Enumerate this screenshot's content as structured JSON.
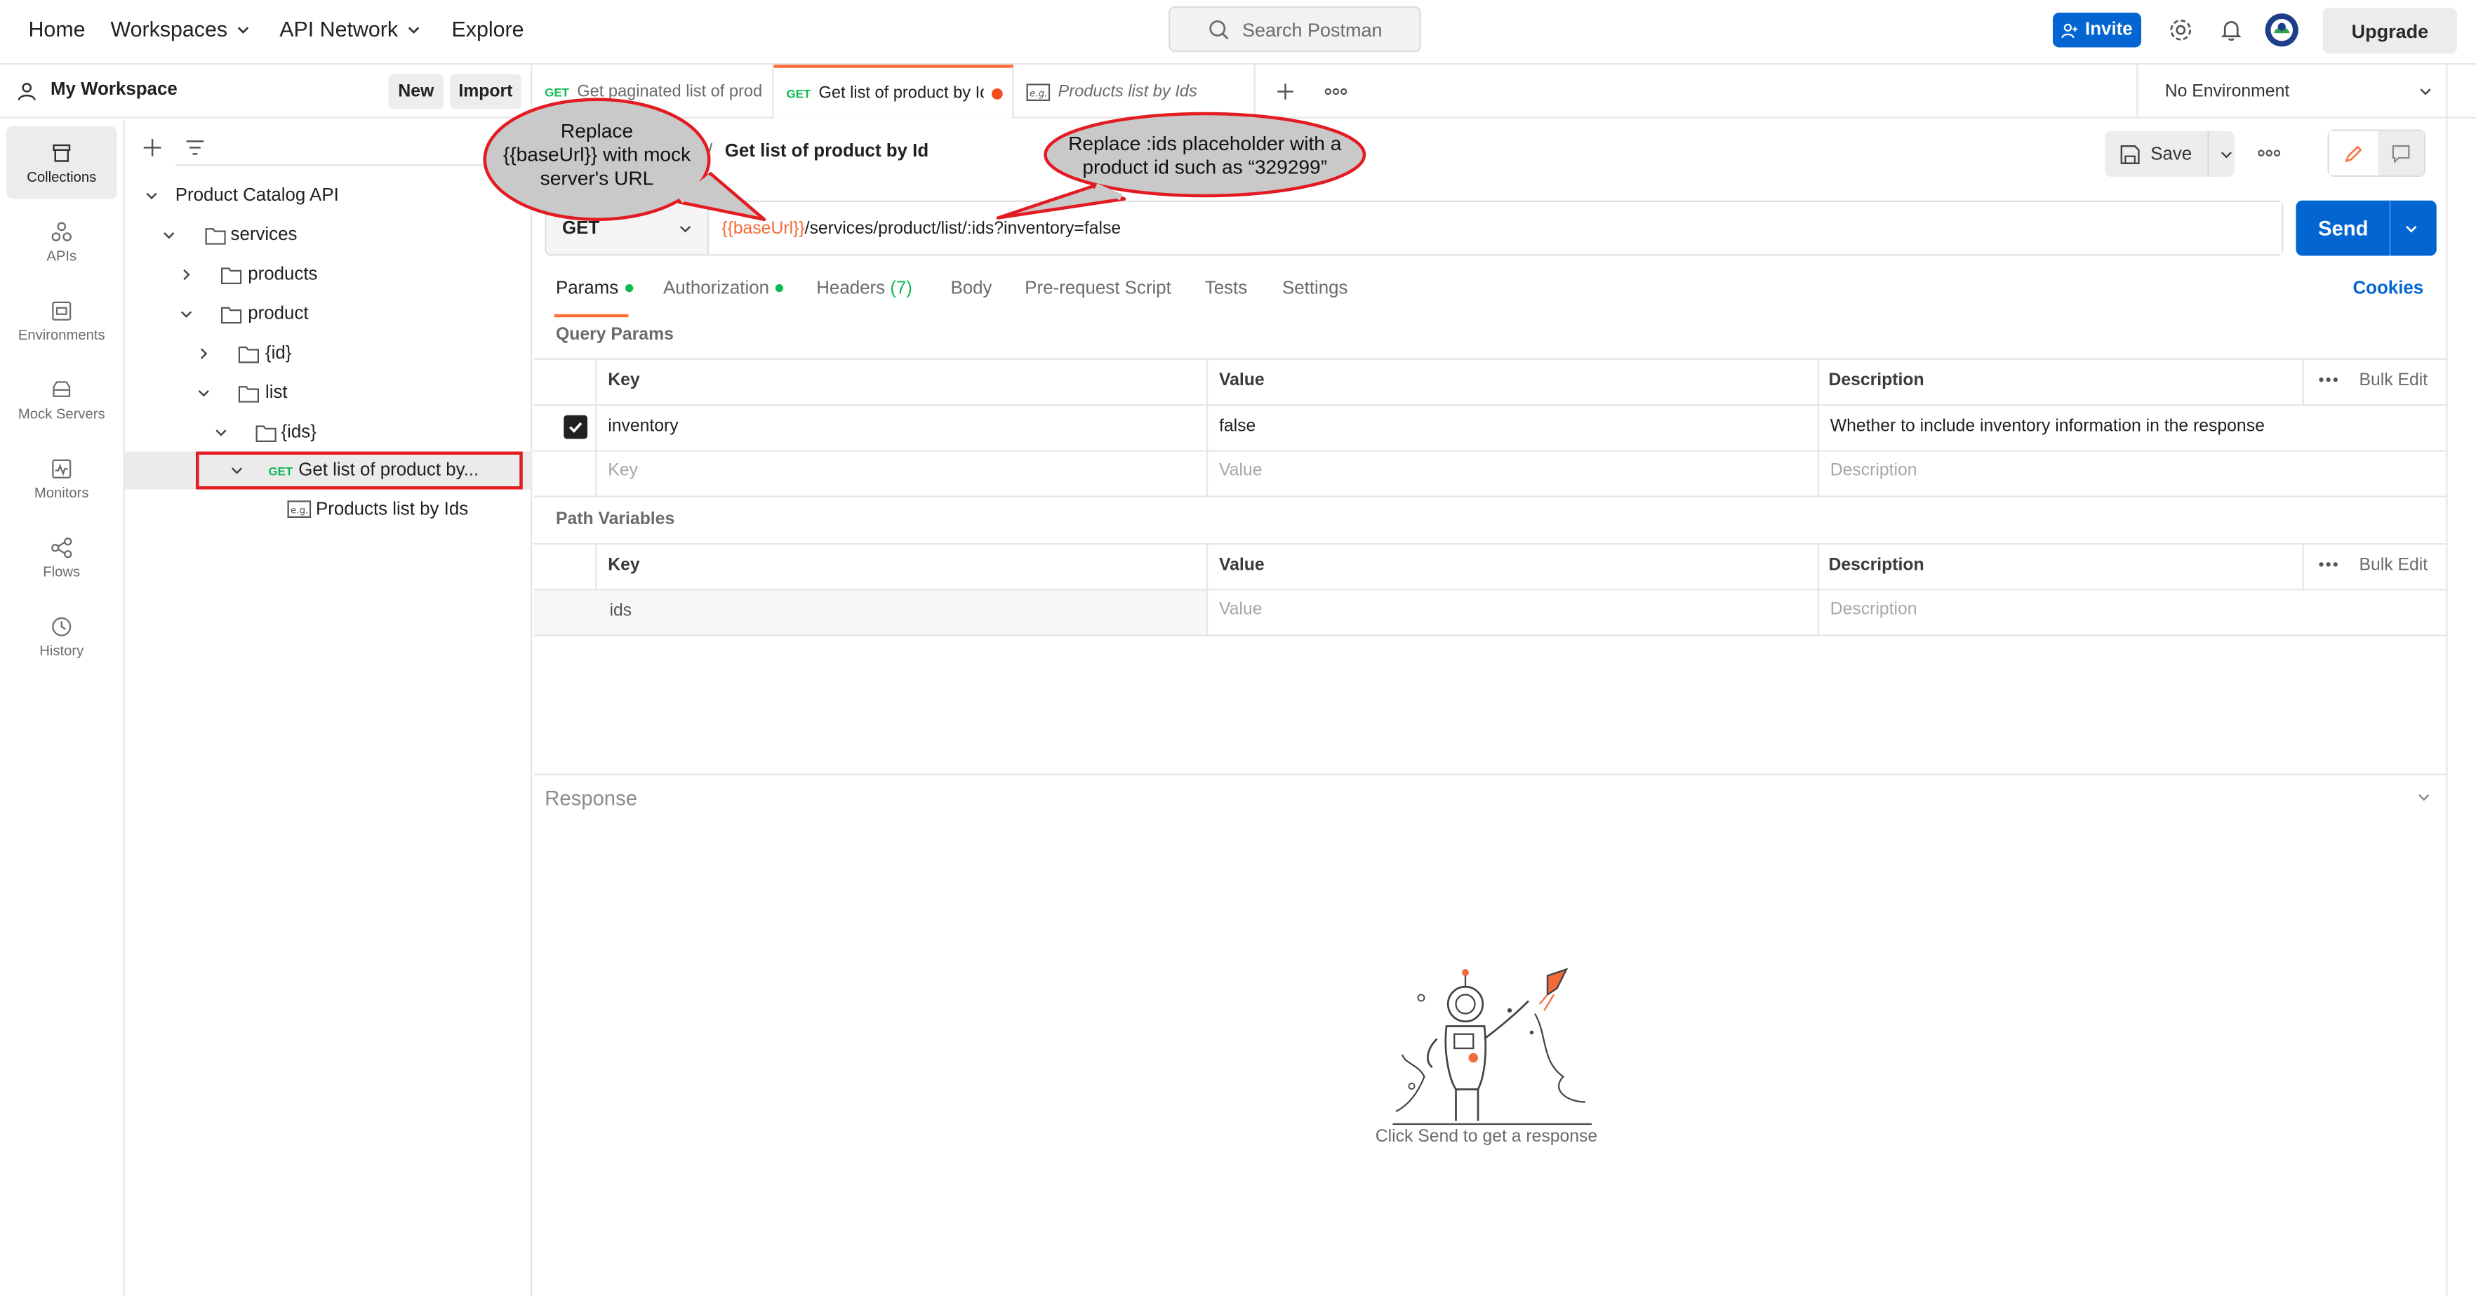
{
  "topbar": {
    "home": "Home",
    "workspaces": "Workspaces",
    "api_network": "API Network",
    "explore": "Explore",
    "search_placeholder": "Search Postman",
    "invite": "Invite",
    "upgrade": "Upgrade"
  },
  "workspace": {
    "name": "My Workspace",
    "new_label": "New",
    "import_label": "Import"
  },
  "iconbar": {
    "collections": "Collections",
    "apis": "APIs",
    "environments": "Environments",
    "mock_servers": "Mock Servers",
    "monitors": "Monitors",
    "flows": "Flows",
    "history": "History"
  },
  "tree": {
    "root": "Product Catalog API",
    "services": "services",
    "products": "products",
    "product": "product",
    "id": "{id}",
    "list": "list",
    "ids": "{ids}",
    "get_method": "GET",
    "request": "Get list of product by...",
    "example": "Products list by Ids"
  },
  "tabs": {
    "tab1_method": "GET",
    "tab1_label": "Get paginated list of prod",
    "tab2_method": "GET",
    "tab2_label": "Get list of product by Id",
    "tab3_label": "Products list by Ids",
    "environment": "No Environment"
  },
  "request": {
    "breadcrumb_sep": "/",
    "title": "Get list of product by Id",
    "save": "Save",
    "method": "GET",
    "url_var": "{{baseUrl}}",
    "url_rest": "/services/product/list/:ids?inventory=false",
    "send": "Send"
  },
  "param_tabs": {
    "params": "Params",
    "authorization": "Authorization",
    "headers": "Headers",
    "headers_count": "(7)",
    "body": "Body",
    "prerequest": "Pre-request Script",
    "tests": "Tests",
    "settings": "Settings",
    "cookies": "Cookies"
  },
  "query_params": {
    "title": "Query Params",
    "col_key": "Key",
    "col_value": "Value",
    "col_desc": "Description",
    "bulk_edit": "Bulk Edit",
    "row_key": "inventory",
    "row_value": "false",
    "row_desc": "Whether to include inventory information in the response",
    "ph_key": "Key",
    "ph_value": "Value",
    "ph_desc": "Description"
  },
  "path_vars": {
    "title": "Path Variables",
    "col_key": "Key",
    "col_value": "Value",
    "col_desc": "Description",
    "bulk_edit": "Bulk Edit",
    "row_key": "ids",
    "ph_value": "Value",
    "ph_desc": "Description"
  },
  "response": {
    "title": "Response",
    "empty": "Click Send to get a response"
  },
  "callouts": {
    "left_line1": "Replace",
    "left_line2": "{{baseUrl}} with mock",
    "left_line3": "server's URL",
    "right_line1": "Replace :ids placeholder with a",
    "right_line2": "product id such as “329299”"
  },
  "colors": {
    "accent_orange": "#ff6c37",
    "send_blue": "#0265d2",
    "get_green": "#0cbb52",
    "callout_fill": "#c9c9c9",
    "callout_border": "#e31b23"
  }
}
